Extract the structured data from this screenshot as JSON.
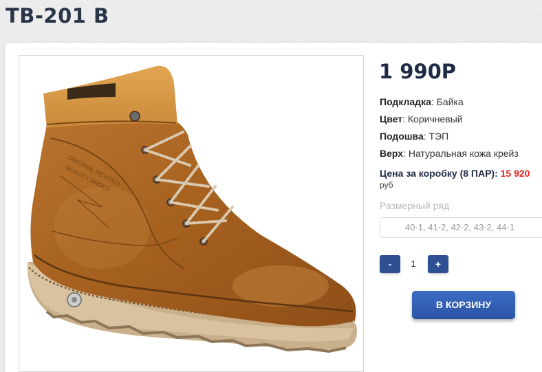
{
  "product": {
    "title": "TB-201 B",
    "price": "1 990Р",
    "image_alt": "brown leather boot"
  },
  "specs": [
    {
      "label": "Подкладка",
      "value": "Байка"
    },
    {
      "label": "Цвет",
      "value": "Коричневый"
    },
    {
      "label": "Подошва",
      "value": "ТЭП"
    },
    {
      "label": "Верх",
      "value": "Натуральная кожа крейз"
    }
  ],
  "box_price": {
    "label": "Цена за коробку (8 ПАР):",
    "value": "15 920",
    "currency": "руб"
  },
  "sizes": {
    "label": "Размерный ряд",
    "selected": "40-1, 41-2, 42-2, 43-2, 44-1"
  },
  "quantity": {
    "minus_label": "-",
    "value": "1",
    "plus_label": "+"
  },
  "cart_button": "В КОРЗИНУ",
  "colors": {
    "accent": "#2f4f93",
    "price_red": "#e2231a",
    "title": "#2b3548"
  }
}
